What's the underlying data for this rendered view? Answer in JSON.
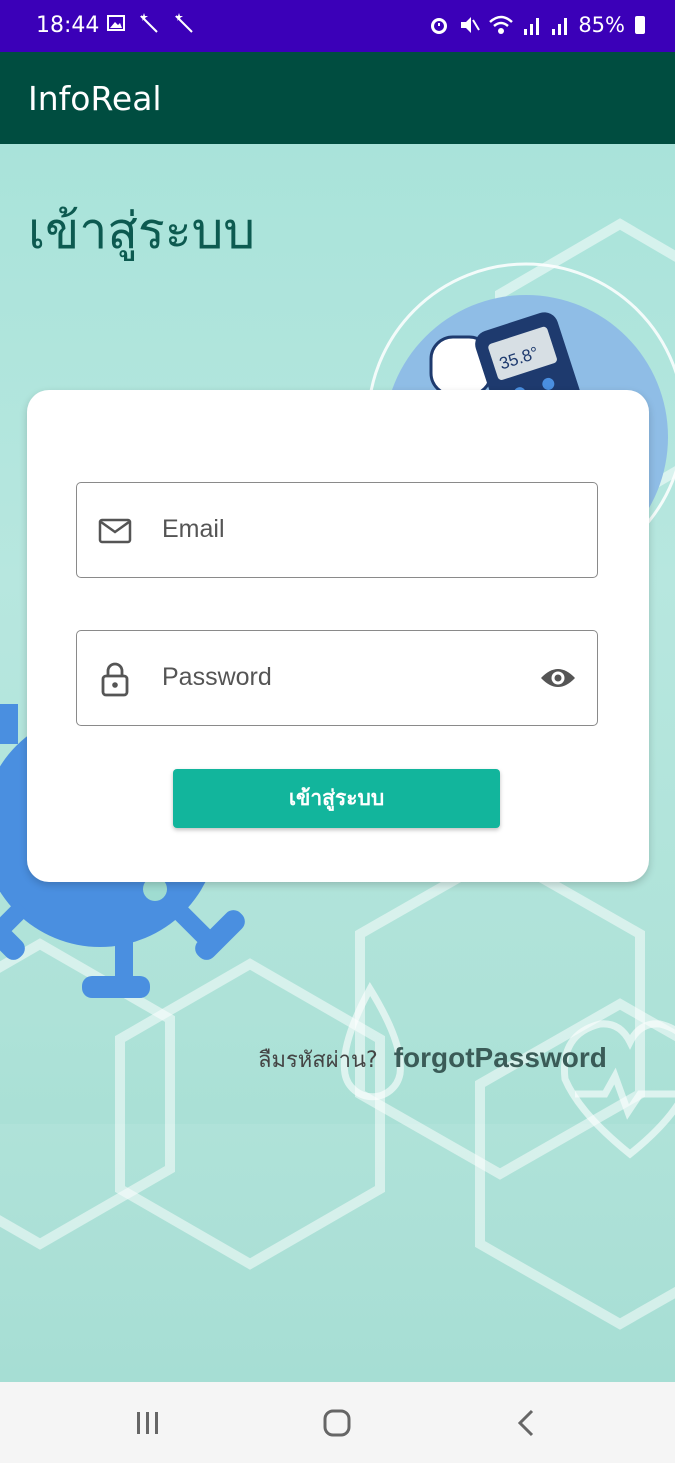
{
  "status_bar": {
    "time": "18:44",
    "left_icons": [
      "image-icon",
      "magic-wand-icon",
      "magic-wand-icon"
    ],
    "battery_percent": "85%",
    "right_icons": [
      "alarm-icon",
      "mute-icon",
      "wifi-icon",
      "signal-icon",
      "signal-icon",
      "battery-icon"
    ]
  },
  "app_bar": {
    "title": "InfoReal"
  },
  "page": {
    "heading": "เข้าสู่ระบบ"
  },
  "login_form": {
    "email_placeholder": "Email",
    "password_placeholder": "Password",
    "submit_label": "เข้าสู่ระบบ"
  },
  "forgot": {
    "label": "ลืมรหัสผ่าน?",
    "link": "forgotPassword"
  },
  "thermometer_display": "35.8°",
  "colors": {
    "status_bar": "#3b00b8",
    "app_bar": "#004d40",
    "accent": "#12b59c",
    "virus": "#4a8fe0"
  }
}
